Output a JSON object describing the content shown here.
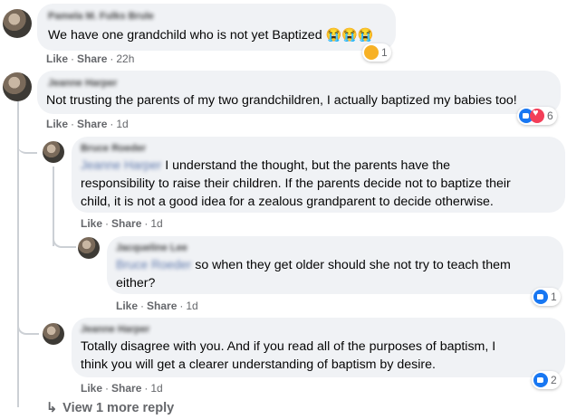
{
  "comments": [
    {
      "author": "Pamela M. Fulks Brule",
      "text": "We have one grandchild who is not yet Baptized 😭😭😭",
      "like_label": "Like",
      "share_label": "Share",
      "time": "22h",
      "reaction_count": "1",
      "reaction_icons": [
        "sad-icon"
      ]
    },
    {
      "author": "Jeanne Harper",
      "text": "Not trusting the parents of my two grandchildren, I actually baptized my babies too!",
      "like_label": "Like",
      "share_label": "Share",
      "time": "1d",
      "reaction_count": "6",
      "reaction_icons": [
        "like-icon",
        "love-icon"
      ]
    }
  ],
  "replies": [
    {
      "author": "Bruce Roeder",
      "mention": "Jeanne Harper",
      "text_line1": "I understand the thought, but the parents have the",
      "text_line2": "responsibility to raise their children. If the parents decide not to baptize their",
      "text_line3": "child, it is not a good idea for a zealous grandparent to decide otherwise.",
      "like_label": "Like",
      "share_label": "Share",
      "time": "1d"
    },
    {
      "author": "Jacqueline Lee",
      "mention": "Bruce Roeder",
      "text_line1": "so when they get older should she not try to teach them",
      "text_line2": "either?",
      "like_label": "Like",
      "share_label": "Share",
      "time": "1d",
      "reaction_count": "1",
      "reaction_icons": [
        "like-icon"
      ]
    },
    {
      "author": "Jeanne Harper",
      "text_line1": "Totally disagree with you. And if you read all of the purposes of baptism, I",
      "text_line2": "think you will get a clearer understanding of baptism by desire.",
      "like_label": "Like",
      "share_label": "Share",
      "time": "1d",
      "reaction_count": "2",
      "reaction_icons": [
        "like-icon"
      ]
    }
  ],
  "more_replies": {
    "arrow": "↳",
    "label": "View 1 more reply"
  },
  "colors": {
    "bubble": "#f0f2f5",
    "meta": "#65676b",
    "like": "#1877f2",
    "love": "#f33e58",
    "sad": "#f7b125"
  }
}
